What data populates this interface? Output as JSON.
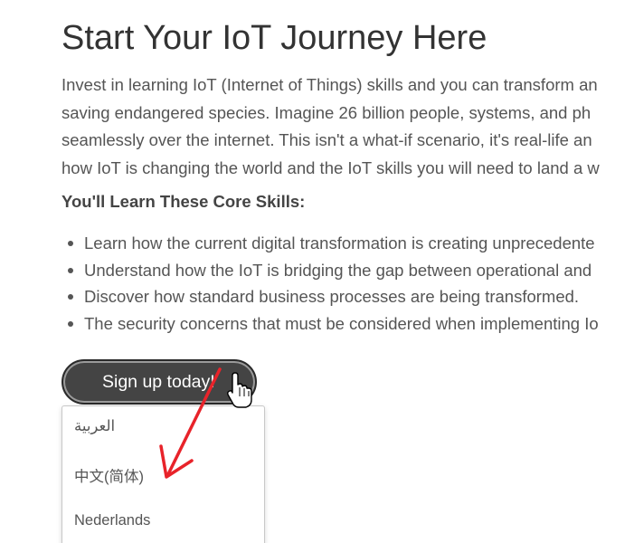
{
  "page": {
    "title": "Start Your IoT Journey Here",
    "intro_lines": [
      "Invest in learning IoT (Internet of Things) skills and you can transform an",
      "saving endangered species. Imagine 26 billion people, systems, and ph",
      "seamlessly over the internet. This isn't a what-if scenario, it's real-life an",
      "how IoT is changing the world and the IoT skills you will need to land a w"
    ],
    "skills_heading": "You'll Learn These Core Skills:",
    "skills": [
      "Learn how the current digital transformation is creating unprecedente",
      "Understand how the IoT is bridging the gap between operational and",
      "Discover how standard business processes are being transformed.",
      "The security concerns that must be considered when implementing Io"
    ]
  },
  "signup_button": {
    "label": "Sign up today!"
  },
  "language_dropdown": {
    "options": [
      "العربية",
      "中文(简体)",
      "Nederlands"
    ]
  },
  "annotation": {
    "arrow_color": "#e8232a",
    "cursor": "hand-pointer-icon"
  }
}
